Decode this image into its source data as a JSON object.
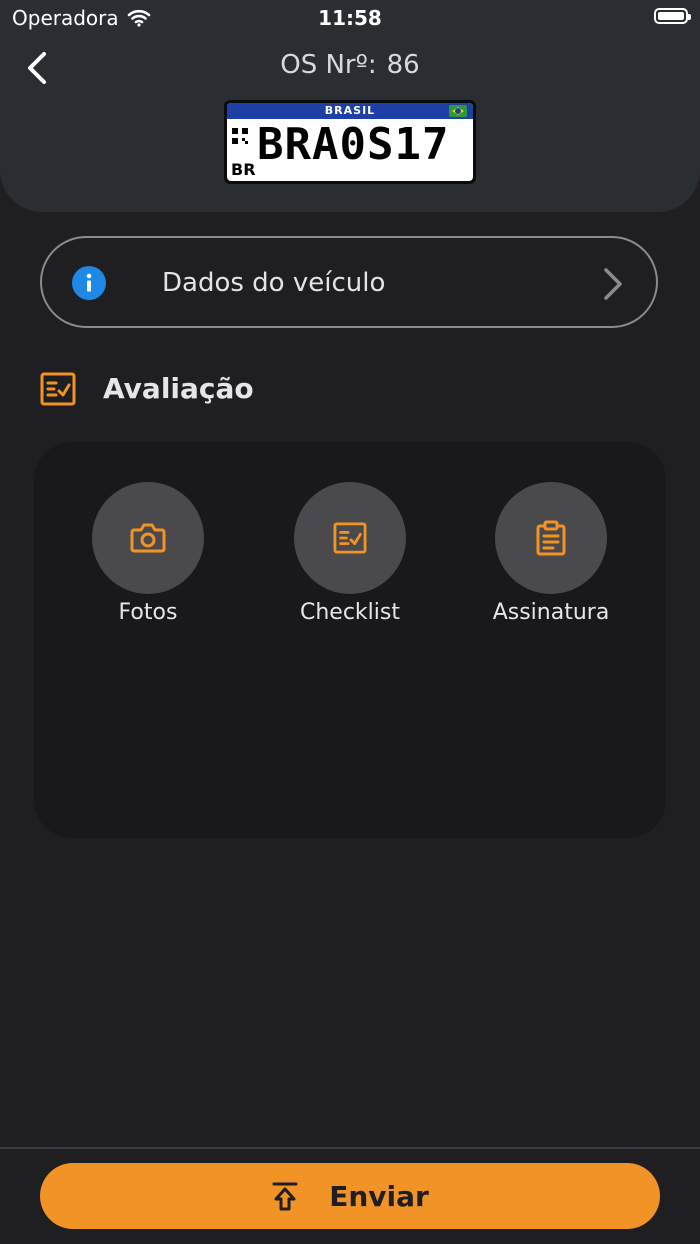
{
  "status_bar": {
    "carrier": "Operadora",
    "time": "11:58"
  },
  "header": {
    "os_label": "OS Nrº:",
    "os_number": "86",
    "plate": {
      "country": "BRASIL",
      "code": "BR",
      "number": "BRA0S17"
    }
  },
  "vehicle_card": {
    "label": "Dados do veículo"
  },
  "section": {
    "title": "Avaliação"
  },
  "tiles": [
    {
      "label": "Fotos",
      "icon": "camera-icon"
    },
    {
      "label": "Checklist",
      "icon": "checklist-icon"
    },
    {
      "label": "Assinatura",
      "icon": "clipboard-icon"
    }
  ],
  "footer": {
    "send_label": "Enviar"
  },
  "colors": {
    "accent": "#f29326",
    "info": "#1e88e5",
    "background": "#1f1f22",
    "header": "#2a2d32"
  }
}
